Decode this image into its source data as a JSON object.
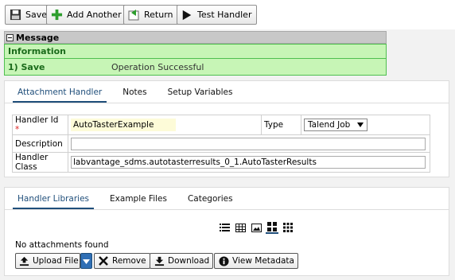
{
  "toolbar": {
    "save": "Save",
    "add_another": "Add Another",
    "return": "Return",
    "test_handler": "Test Handler"
  },
  "message": {
    "header": "Message",
    "category": "Information",
    "item_key": "1) Save",
    "item_value": "Operation Successful"
  },
  "attachment_panel": {
    "tabs": [
      "Attachment Handler",
      "Notes",
      "Setup Variables"
    ],
    "handler_id_label": "Handler Id",
    "handler_id_value": "AutoTasterExample",
    "type_label": "Type",
    "type_value": "Talend Job",
    "description_label": "Description",
    "description_value": "",
    "handler_class_label": "Handler Class",
    "handler_class_value": "labvantage_sdms.autotasterresults_0_1.AutoTasterResults"
  },
  "libraries_panel": {
    "tabs": [
      "Handler Libraries",
      "Example Files",
      "Categories"
    ],
    "empty_text": "No attachments found",
    "upload": "Upload File",
    "remove": "Remove",
    "download": "Download",
    "view_metadata": "View Metadata"
  },
  "colors": {
    "accent": "#1f4e7a",
    "success_bg": "#c7f5b6",
    "success_border": "#4fbf4f",
    "upload_split": "#2f6fb5"
  }
}
